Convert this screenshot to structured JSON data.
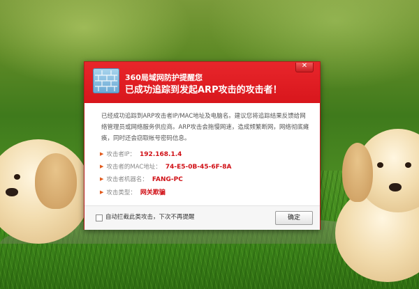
{
  "dialog": {
    "app_title": "360局域网防护提醒您",
    "headline": "已成功追踪到发起ARP攻击的攻击者！",
    "close_glyph": "✕",
    "message": "已经成功追踪到ARP攻击者IP/MAC地址及电脑名。建议您将追踪结果反馈给网络管理员或网络服务供应商。ARP攻击会拖慢网速，造成频繁断网，网络彻底瘫痪，同时还会窃取帐号密码信息。",
    "details": [
      {
        "label": "攻击者IP：",
        "value": "192.168.1.4"
      },
      {
        "label": "攻击者的MAC地址：",
        "value": "74-E5-0B-45-6F-8A"
      },
      {
        "label": "攻击者机器名：",
        "value": "FANG-PC"
      },
      {
        "label": "攻击类型：",
        "value": "网关欺骗"
      }
    ],
    "checkbox_label": "自动拦截此类攻击，下次不再提醒",
    "checkbox_checked": false,
    "ok_label": "确定"
  },
  "colors": {
    "titlebar": "#e01e24",
    "value_red": "#d01016",
    "bullet_orange": "#e25a1c"
  },
  "icons": {
    "logo": "firewall-brick-icon",
    "close": "close-icon",
    "bullet": "triangle-bullet-icon"
  }
}
